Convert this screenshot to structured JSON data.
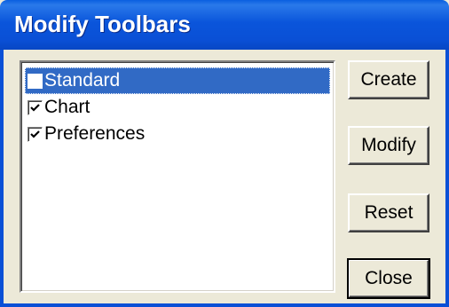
{
  "window": {
    "title": "Modify Toolbars"
  },
  "toolbar_list": {
    "items": [
      {
        "label": "Standard",
        "checked": false,
        "selected": true
      },
      {
        "label": "Chart",
        "checked": true,
        "selected": false
      },
      {
        "label": "Preferences",
        "checked": true,
        "selected": false
      }
    ]
  },
  "buttons": {
    "create_label": "Create",
    "modify_label": "Modify",
    "reset_label": "Reset",
    "close_label": "Close"
  },
  "colors": {
    "title_bar": "#0a55db",
    "selection": "#316ac5",
    "dialog_face": "#ece9d8"
  }
}
